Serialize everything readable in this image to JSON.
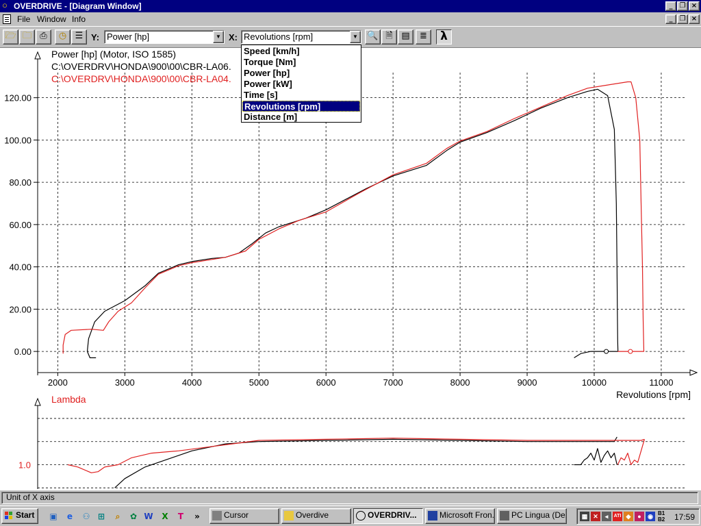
{
  "window": {
    "title": "OVERDRIVE - [Diagram Window]"
  },
  "menu": {
    "file": "File",
    "window": "Window",
    "info": "Info"
  },
  "toolbar": {
    "y_label": "Y:",
    "y_value": "Power [hp]",
    "x_label": "X:",
    "x_value": "Revolutions [rpm]",
    "lambda_glyph": "λ"
  },
  "dropdown": {
    "options": [
      "Speed [km/h]",
      "Torque [Nm]",
      "Power [hp]",
      "Power [kW]",
      "Time [s]",
      "Revolutions [rpm]",
      "Distance [m]"
    ],
    "selected_index": 5
  },
  "legend": {
    "line1": "Power [hp] (Motor, ISO 1585)",
    "line2": "C:\\OVERDRV\\HONDA\\900\\00\\CBR-LA06.",
    "line3": "C:\\OVERDRV\\HONDA\\900\\00\\CBR-LA04."
  },
  "colors": {
    "series_black": "#000000",
    "series_red": "#e02020",
    "titlebar": "#000080"
  },
  "chart_data": [
    {
      "type": "line",
      "title": "Power [hp] (Motor, ISO 1585)",
      "xlabel": "Revolutions [rpm]",
      "ylabel": "Power [hp]",
      "xlim": [
        1700,
        11450
      ],
      "ylim": [
        -10,
        139
      ],
      "x_ticks": [
        2000,
        3000,
        4000,
        5000,
        6000,
        7000,
        8000,
        9000,
        10000,
        11000
      ],
      "y_ticks": [
        0,
        20,
        40,
        60,
        80,
        100,
        120
      ],
      "x_tick_labels": [
        "2000",
        "3000",
        "4000",
        "5000",
        "6000",
        "7000",
        "8000",
        "9000",
        "10000",
        "11000"
      ],
      "y_tick_labels": [
        "0.00",
        "20.00",
        "40.00",
        "60.00",
        "80.00",
        "100.00",
        "120.00"
      ],
      "grid": true,
      "series": [
        {
          "name": "C:\\OVERDRV\\HONDA\\900\\00\\CBR-LA06.",
          "color": "#000000",
          "segments": [
            [
              [
                2570,
                -3
              ],
              [
                2480,
                -3
              ],
              [
                2440,
                0
              ],
              [
                2460,
                6
              ],
              [
                2550,
                14
              ],
              [
                2700,
                19
              ],
              [
                3000,
                24
              ],
              [
                3300,
                31
              ],
              [
                3500,
                37
              ],
              [
                3800,
                41
              ],
              [
                4000,
                42.5
              ],
              [
                4300,
                44
              ],
              [
                4500,
                44.5
              ],
              [
                4700,
                46.5
              ],
              [
                4900,
                51
              ],
              [
                5100,
                56
              ],
              [
                5300,
                59
              ],
              [
                5500,
                61
              ],
              [
                5700,
                63
              ],
              [
                6000,
                67
              ],
              [
                6300,
                72
              ],
              [
                6600,
                77
              ],
              [
                7000,
                83
              ],
              [
                7500,
                88
              ],
              [
                7800,
                95
              ],
              [
                8000,
                99
              ],
              [
                8400,
                103.5
              ],
              [
                8800,
                109
              ],
              [
                9200,
                115
              ],
              [
                9600,
                120
              ],
              [
                9900,
                123
              ],
              [
                10050,
                124
              ],
              [
                10200,
                121
              ],
              [
                10300,
                105
              ],
              [
                10330,
                70
              ],
              [
                10340,
                40
              ],
              [
                10345,
                20
              ],
              [
                10350,
                5
              ],
              [
                10355,
                0
              ],
              [
                10200,
                0
              ],
              [
                9950,
                0
              ],
              [
                9800,
                -1
              ],
              [
                9700,
                -3
              ]
            ]
          ]
        },
        {
          "name": "C:\\OVERDRV\\HONDA\\900\\00\\CBR-LA04.",
          "color": "#e02020",
          "segments": [
            [
              [
                2080,
                -1
              ],
              [
                2080,
                3
              ],
              [
                2110,
                8
              ],
              [
                2200,
                10
              ],
              [
                2500,
                10.5
              ],
              [
                2680,
                10
              ],
              [
                2760,
                14
              ],
              [
                2900,
                19
              ],
              [
                3100,
                23
              ],
              [
                3300,
                30
              ],
              [
                3500,
                36.5
              ],
              [
                3800,
                40.5
              ],
              [
                4000,
                42
              ],
              [
                4300,
                43.5
              ],
              [
                4500,
                44.5
              ],
              [
                4800,
                47.5
              ],
              [
                5000,
                53
              ],
              [
                5300,
                58
              ],
              [
                5600,
                62
              ],
              [
                6000,
                66
              ],
              [
                6500,
                75
              ],
              [
                7000,
                83.5
              ],
              [
                7500,
                89
              ],
              [
                7800,
                96
              ],
              [
                8000,
                99.5
              ],
              [
                8400,
                104
              ],
              [
                8800,
                110
              ],
              [
                9200,
                115.5
              ],
              [
                9600,
                121
              ],
              [
                9900,
                124.5
              ],
              [
                10200,
                126
              ],
              [
                10500,
                127.5
              ],
              [
                10550,
                127.5
              ],
              [
                10620,
                120
              ],
              [
                10680,
                100
              ],
              [
                10700,
                70
              ],
              [
                10720,
                40
              ],
              [
                10730,
                15
              ],
              [
                10740,
                0
              ],
              [
                10600,
                0
              ],
              [
                10500,
                0
              ],
              [
                10350,
                0
              ]
            ]
          ]
        }
      ],
      "markers": [
        {
          "series": "black",
          "x": 10180,
          "y": 0
        },
        {
          "series": "red",
          "x": 10540,
          "y": 0
        }
      ]
    },
    {
      "type": "line",
      "title": "Lambda",
      "ylabel": "Lambda",
      "xlim": [
        1700,
        11450
      ],
      "ylim": [
        0.895,
        1.262
      ],
      "y_ticks": [
        1.0
      ],
      "y_tick_labels": [
        "1.0"
      ],
      "grid": true,
      "series": [
        {
          "name": "black",
          "color": "#000000",
          "segments": [
            [
              [
                2850,
                0.9
              ],
              [
                3000,
                0.94
              ],
              [
                3300,
                0.99
              ],
              [
                3600,
                1.02
              ],
              [
                4000,
                1.06
              ],
              [
                4500,
                1.09
              ],
              [
                5000,
                1.1
              ],
              [
                6000,
                1.105
              ],
              [
                7000,
                1.11
              ],
              [
                8000,
                1.105
              ],
              [
                9000,
                1.1
              ],
              [
                9600,
                1.1
              ],
              [
                10000,
                1.1
              ],
              [
                10300,
                1.1
              ],
              [
                10340,
                1.12
              ]
            ],
            [
              [
                9700,
                1.0
              ],
              [
                9800,
                1.0
              ],
              [
                9850,
                1.02
              ],
              [
                9900,
                1.03
              ],
              [
                9950,
                1.05
              ],
              [
                10000,
                1.02
              ],
              [
                10050,
                1.07
              ],
              [
                10100,
                1.01
              ],
              [
                10150,
                1.04
              ],
              [
                10200,
                1.06
              ],
              [
                10250,
                1.03
              ],
              [
                10300,
                1.05
              ],
              [
                10340,
                1.0
              ]
            ]
          ]
        },
        {
          "name": "red",
          "color": "#e02020",
          "segments": [
            [
              [
                2150,
                1.0
              ],
              [
                2300,
                0.99
              ],
              [
                2500,
                0.965
              ],
              [
                2600,
                0.97
              ],
              [
                2700,
                0.99
              ],
              [
                2900,
                1.0
              ],
              [
                3100,
                1.03
              ],
              [
                3400,
                1.05
              ],
              [
                3800,
                1.06
              ],
              [
                4200,
                1.075
              ],
              [
                4600,
                1.09
              ],
              [
                5000,
                1.105
              ],
              [
                6000,
                1.11
              ],
              [
                7000,
                1.115
              ],
              [
                8000,
                1.11
              ],
              [
                9000,
                1.105
              ],
              [
                10000,
                1.105
              ],
              [
                10700,
                1.105
              ],
              [
                10750,
                1.11
              ]
            ],
            [
              [
                10350,
                1.0
              ],
              [
                10400,
                1.03
              ],
              [
                10450,
                1.02
              ],
              [
                10500,
                1.05
              ],
              [
                10550,
                1.0
              ],
              [
                10600,
                1.02
              ],
              [
                10650,
                1.01
              ],
              [
                10700,
                1.06
              ],
              [
                10750,
                1.11
              ]
            ]
          ]
        }
      ]
    }
  ],
  "status": {
    "text": "Unit of X axis"
  },
  "taskbar": {
    "start": "Start",
    "tasks": [
      "Cursor",
      "Overdive",
      "OVERDRIV...",
      "Microsoft Fron...",
      "PC Lingua (De..."
    ],
    "active_index": 2,
    "quicklaunch_more": "»",
    "tray_labels": [
      "B1",
      "B2"
    ],
    "clock": "17:59"
  }
}
